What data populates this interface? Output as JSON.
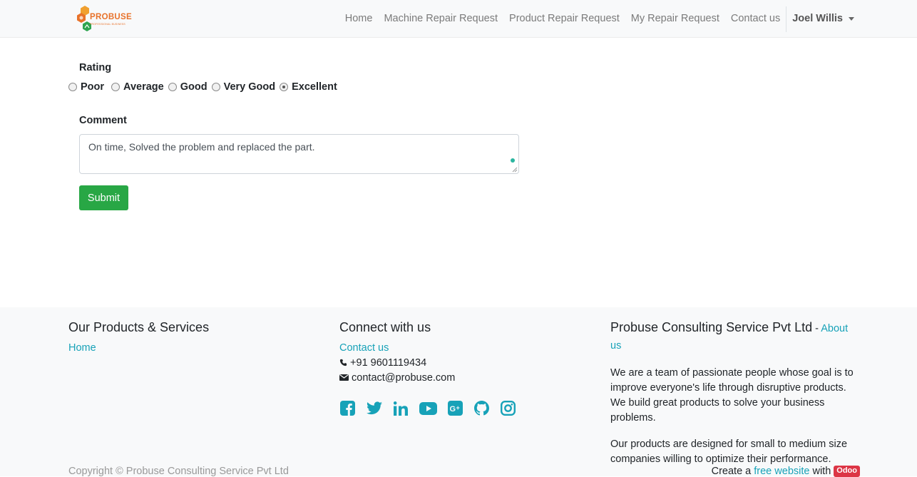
{
  "navbar": {
    "logo_text": "PROBUSE",
    "logo_tagline": "PROFESSIONAL BUSINESS",
    "links": [
      "Home",
      "Machine Repair Request",
      "Product Repair Request",
      "My Repair Request",
      "Contact us"
    ],
    "user_name": "Joel Willis"
  },
  "form": {
    "rating_label": "Rating",
    "rating_options": [
      "Poor",
      "Average",
      "Good",
      "Very Good",
      "Excellent"
    ],
    "rating_selected": "Excellent",
    "comment_label": "Comment",
    "comment_value": "On time, Solved the problem and replaced the part.",
    "submit_label": "Submit"
  },
  "footer": {
    "products_title": "Our Products & Services",
    "products_links": [
      "Home"
    ],
    "connect_title": "Connect with us",
    "connect_link": "Contact us",
    "phone": "+91 9601119434",
    "email": "contact@probuse.com",
    "social_icons": [
      "facebook-icon",
      "twitter-icon",
      "linkedin-icon",
      "youtube-icon",
      "google-plus-icon",
      "github-icon",
      "instagram-icon"
    ],
    "company_title": "Probuse Consulting Service Pvt Ltd",
    "company_title_sep": " - ",
    "about_link": "About us",
    "about_p1": "We are a team of passionate people whose goal is to improve everyone's life through disruptive products. We build great products to solve your business problems.",
    "about_p2": "Our products are designed for small to medium size companies willing to optimize their performance.",
    "copyright": "Copyright © Probuse Consulting Service Pvt Ltd",
    "create_prefix": "Create a",
    "create_link": "free website",
    "create_with": "with",
    "odoo_badge": "Odoo"
  },
  "colors": {
    "accent": "#17a2b8",
    "submit": "#28a745",
    "badge": "#dc3545"
  }
}
